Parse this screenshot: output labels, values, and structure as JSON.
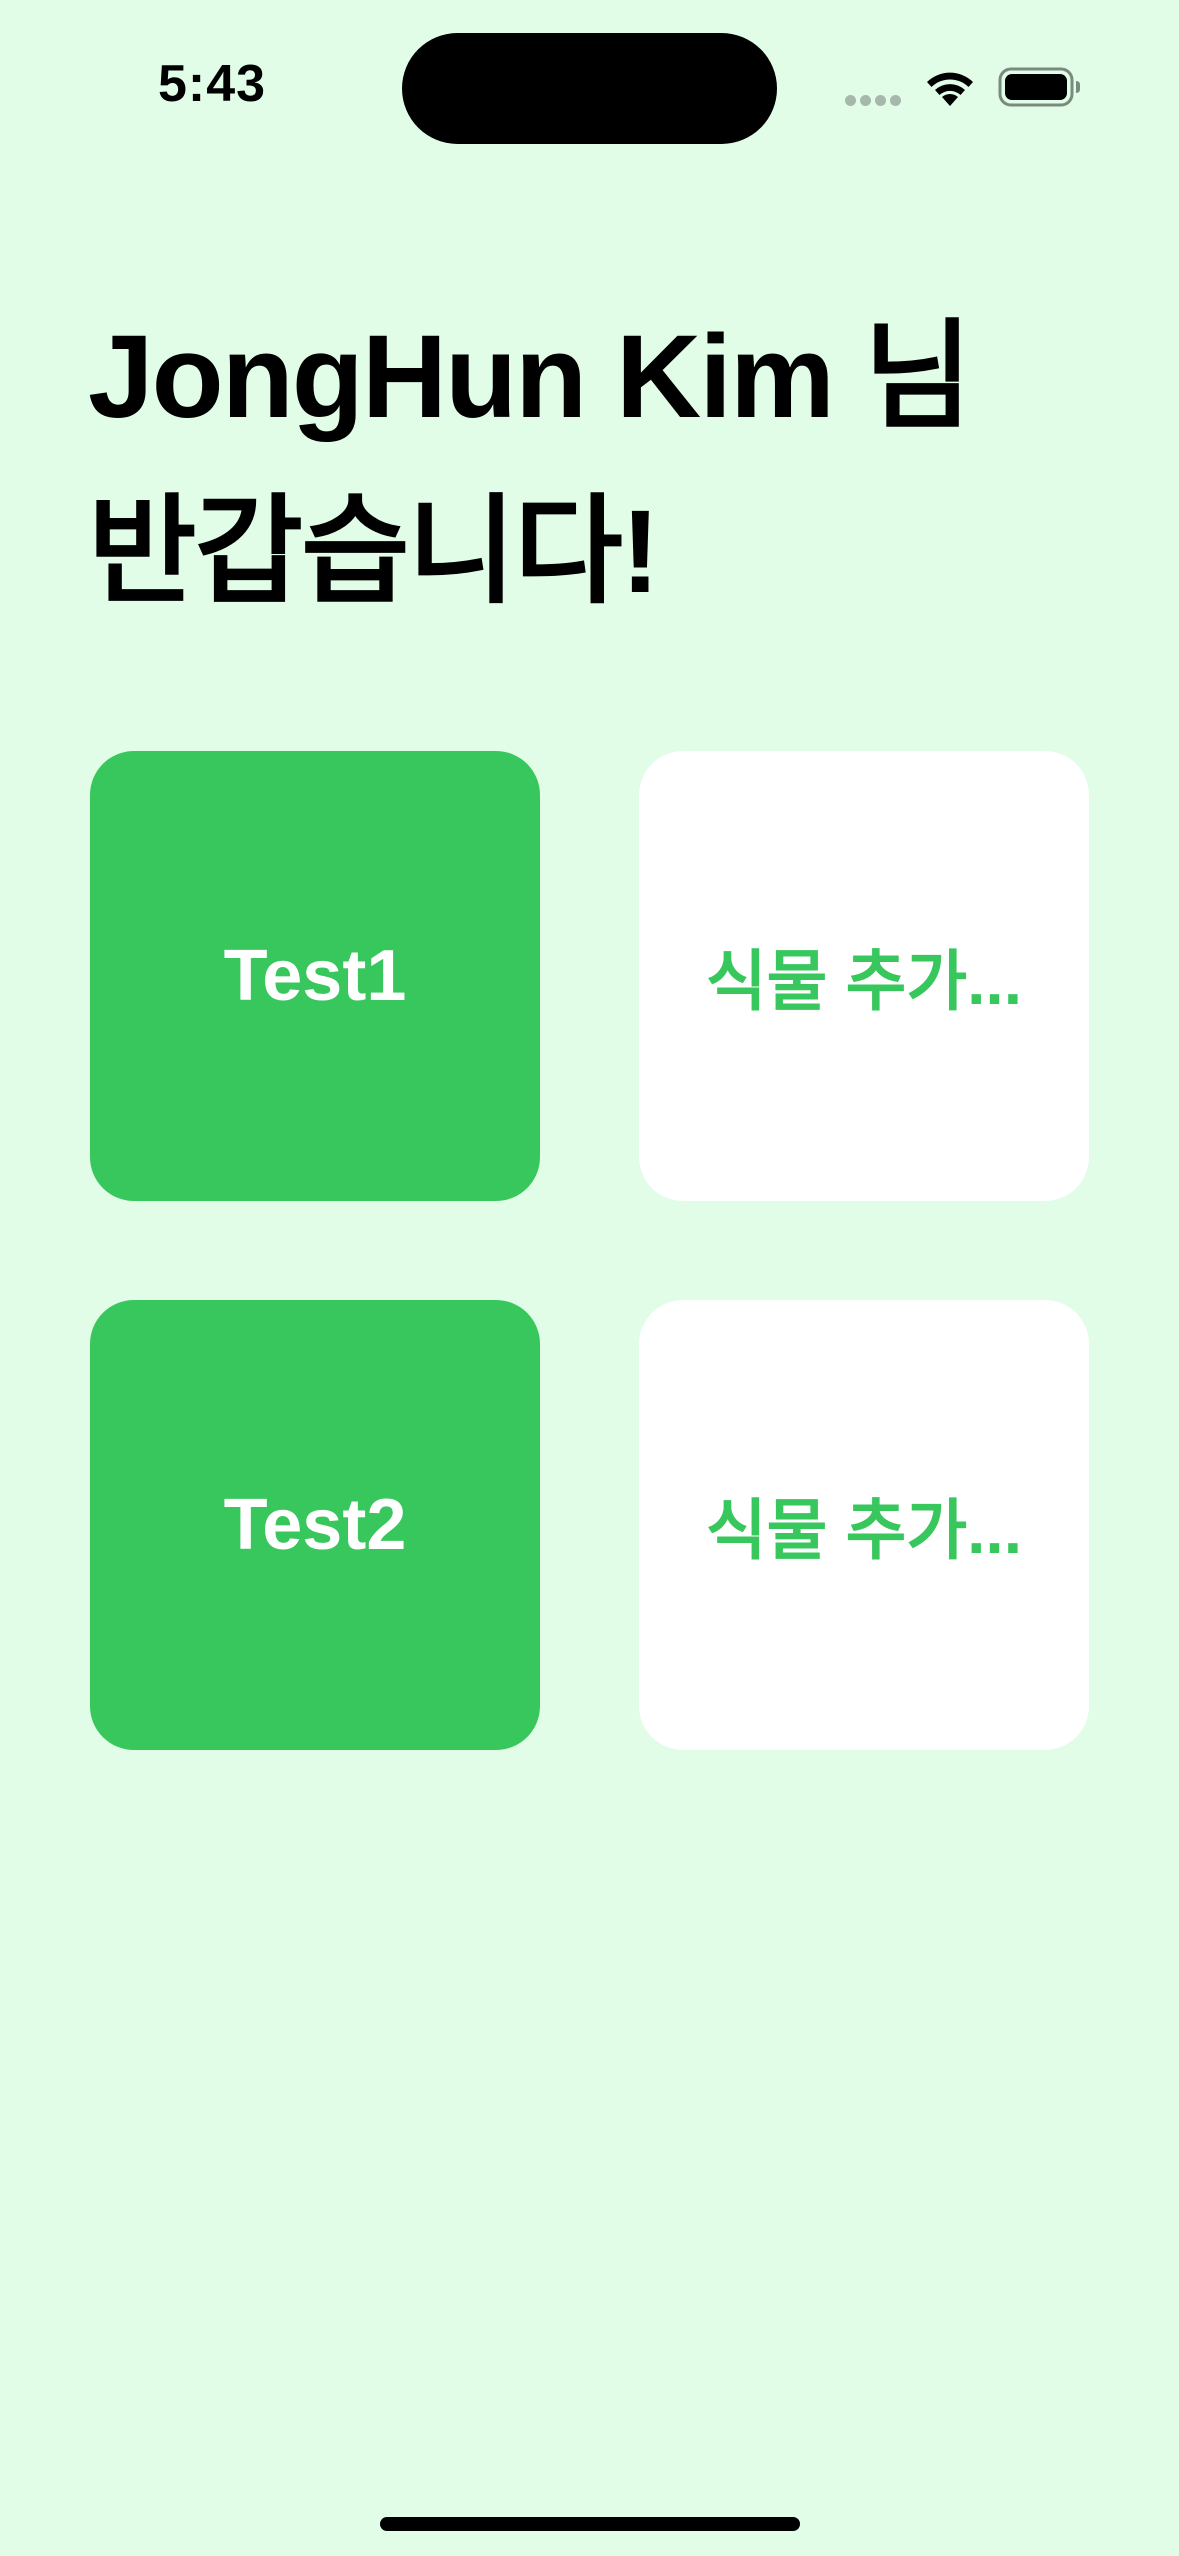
{
  "status_bar": {
    "time": "5:43",
    "wifi_icon": "wifi-icon",
    "battery_icon": "battery-icon"
  },
  "greeting": {
    "line1": "JongHun Kim 님",
    "line2": "반갑습니다!"
  },
  "plants": [
    {
      "label": "Test1"
    },
    {
      "label": "Test2"
    }
  ],
  "add_slots": [
    {
      "label": "식물 추가..."
    },
    {
      "label": "식물 추가..."
    }
  ],
  "colors": {
    "background": "#e1fde7",
    "accent": "#37c75c",
    "card_empty": "#ffffff"
  }
}
